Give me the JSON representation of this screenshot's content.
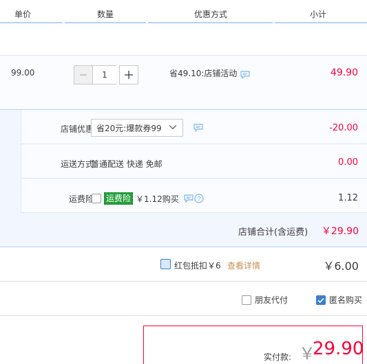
{
  "header": {
    "columns": [
      "单价",
      "数量",
      "优惠方式",
      "小计"
    ]
  },
  "item": {
    "price": "99.00",
    "quantity": "1",
    "promo": "省49.10:店铺活动",
    "subtotal": "49.90"
  },
  "shop": {
    "discount_label": "店铺优惠:",
    "discount_select": "省20元:爆款券99",
    "discount_value": "-20.00",
    "shipping_label": "运送方式:",
    "shipping_text": "普通配送 快递 免邮",
    "shipping_value": "0.00",
    "insurance_label": "运费险:",
    "insurance_badge": "运费险",
    "insurance_text": "￥1.12购买",
    "insurance_value": "1.12",
    "total_label": "店铺合计(含运费)",
    "total_value": "￥29.90"
  },
  "packet": {
    "text": "红包抵扣￥6",
    "link": "查看详情",
    "amount": "￥6.00"
  },
  "options": {
    "friend_pay": "朋友代付",
    "anonymous": "匿名购买"
  },
  "paid": {
    "label": "实付款:",
    "currency": "￥",
    "amount": "29.90"
  },
  "colors": {
    "accent_red": "#ff0036",
    "accent_blue": "#3d7fcf",
    "header_underline": "#b2d1ff",
    "shop_bg": "#f2f7ff",
    "insurance_green": "#23a03a"
  },
  "icons": [
    "minus-icon",
    "plus-icon",
    "chat-icon",
    "chevron-down-icon",
    "help-icon",
    "checkmark-icon"
  ]
}
